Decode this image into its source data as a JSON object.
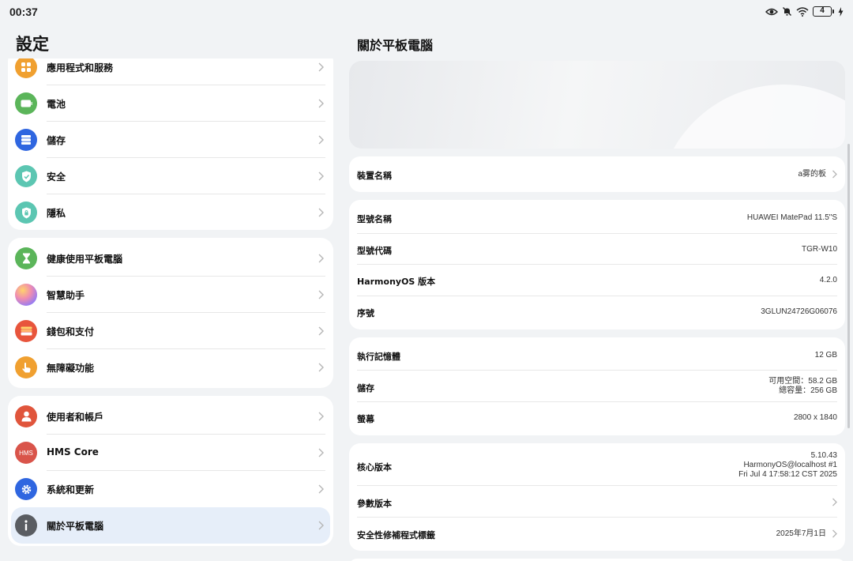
{
  "status_bar": {
    "time": "00:37",
    "battery_level": "4",
    "icons": [
      "eye-icon",
      "bell-off-icon",
      "wifi-icon",
      "battery-icon",
      "charging-icon"
    ]
  },
  "left": {
    "title": "設定",
    "groups": [
      {
        "items": [
          {
            "label": "應用程式和服務",
            "icon": "apps-icon",
            "color": "#f0a030"
          },
          {
            "label": "電池",
            "icon": "battery-setting-icon",
            "color": "#5bb55a"
          },
          {
            "label": "儲存",
            "icon": "storage-icon",
            "color": "#2f66e0"
          },
          {
            "label": "安全",
            "icon": "security-shield-icon",
            "color": "#5cc6b2"
          },
          {
            "label": "隱私",
            "icon": "privacy-icon",
            "color": "#5cc6b2"
          }
        ]
      },
      {
        "items": [
          {
            "label": "健康使用平板電腦",
            "icon": "hourglass-icon",
            "color": "#5bb55a"
          },
          {
            "label": "智慧助手",
            "icon": "assistant-icon",
            "color": "#b483e8"
          },
          {
            "label": "錢包和支付",
            "icon": "wallet-icon",
            "color": "#e8553c"
          },
          {
            "label": "無障礙功能",
            "icon": "accessibility-hand-icon",
            "color": "#f0a030"
          }
        ]
      },
      {
        "items": [
          {
            "label": "使用者和帳戶",
            "icon": "user-icon",
            "color": "#e0553c"
          },
          {
            "label": "HMS Core",
            "icon": "hms-core-icon",
            "icon_text": "HMS",
            "color": "#d9544a"
          },
          {
            "label": "系統和更新",
            "icon": "system-update-gear-icon",
            "color": "#2f66e0"
          },
          {
            "label": "關於平板電腦",
            "icon": "info-icon",
            "color": "#5a5d62",
            "active": true
          }
        ]
      }
    ]
  },
  "right": {
    "title": "關於平板電腦",
    "device_name": {
      "label": "裝置名稱",
      "value": "a雾的板"
    },
    "model": [
      {
        "label": "型號名稱",
        "value": "HUAWEI MatePad 11.5\"S"
      },
      {
        "label": "型號代碼",
        "value": "TGR-W10"
      },
      {
        "label": "HarmonyOS 版本",
        "value": "4.2.0"
      },
      {
        "label": "序號",
        "value": "3GLUN24726G06076"
      }
    ],
    "hardware": [
      {
        "label": "執行記憶體",
        "value": "12 GB"
      },
      {
        "label": "儲存",
        "value_lines": [
          "可用空間：58.2 GB",
          "總容量：256 GB"
        ]
      },
      {
        "label": "螢幕",
        "value": "2800 x 1840"
      }
    ],
    "software": [
      {
        "label": "核心版本",
        "value_lines": [
          "5.10.43",
          "HarmonyOS@localhost #1",
          "Fri Jul 4 17:58:12 CST 2025"
        ]
      },
      {
        "label": "參數版本",
        "value": ""
      },
      {
        "label": "安全性修補程式標籤",
        "value": "2025年7月1日"
      }
    ]
  }
}
